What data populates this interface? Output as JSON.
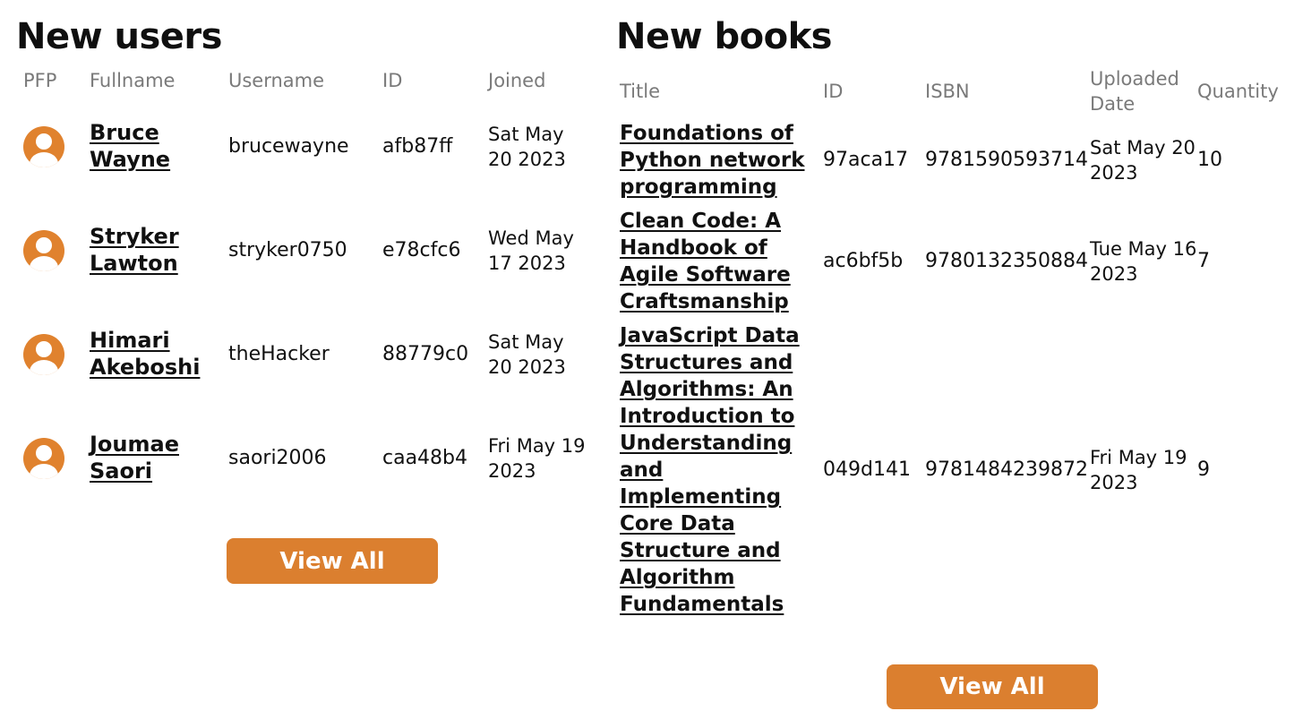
{
  "users": {
    "title": "New users",
    "columns": [
      "PFP",
      "Fullname",
      "Username",
      "ID",
      "Joined"
    ],
    "rows": [
      {
        "avatar": "user-avatar-icon",
        "fullname": "Bruce Wayne",
        "username": "brucewayne",
        "id": "afb87ff",
        "joined": "Sat May 20 2023"
      },
      {
        "avatar": "user-avatar-icon",
        "fullname": "Stryker Lawton",
        "username": "stryker0750",
        "id": "e78cfc6",
        "joined": "Wed May 17 2023"
      },
      {
        "avatar": "user-avatar-icon",
        "fullname": "Himari Akeboshi",
        "username": "theHacker",
        "id": "88779c0",
        "joined": "Sat May 20 2023"
      },
      {
        "avatar": "user-avatar-icon",
        "fullname": "Joumae Saori",
        "username": "saori2006",
        "id": "caa48b4",
        "joined": "Fri May 19 2023"
      }
    ],
    "view_all_label": "View All"
  },
  "books": {
    "title": "New books",
    "columns": [
      "Title",
      "ID",
      "ISBN",
      "Uploaded Date",
      "Quantity"
    ],
    "rows": [
      {
        "title": "Foundations of Python network programming",
        "id": "97aca17",
        "isbn": "9781590593714",
        "uploaded": "Sat May 20 2023",
        "quantity": "10"
      },
      {
        "title": "Clean Code: A Handbook of Agile Software Craftsmanship",
        "id": "ac6bf5b",
        "isbn": "9780132350884",
        "uploaded": "Tue May 16 2023",
        "quantity": "7"
      },
      {
        "title": "JavaScript Data Structures and Algorithms: An Introduction to Understanding and Implementing Core Data Structure and Algorithm Fundamentals",
        "id": "049d141",
        "isbn": "9781484239872",
        "uploaded": "Fri May 19 2023",
        "quantity": "9"
      }
    ],
    "view_all_label": "View All"
  },
  "colors": {
    "accent": "#db7f2f",
    "header_text": "#7a7a7a",
    "text": "#111111"
  }
}
